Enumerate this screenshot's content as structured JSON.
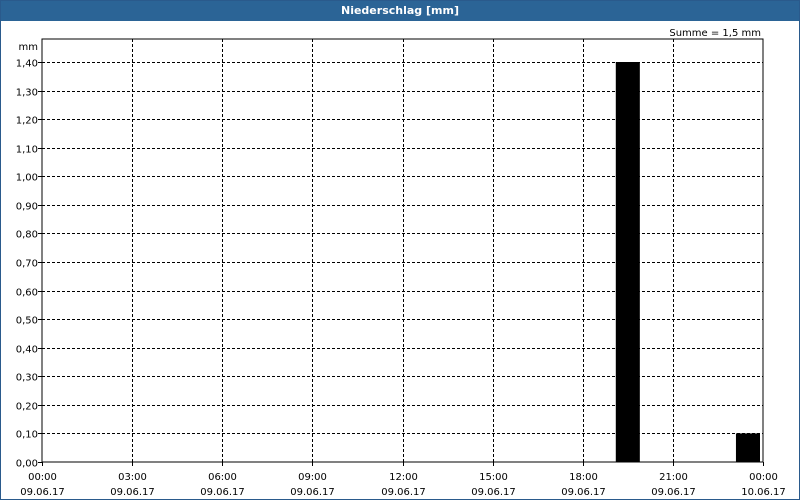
{
  "window": {
    "title": "Niederschlag [mm]"
  },
  "chart_data": {
    "type": "bar",
    "y_unit_label": "mm",
    "summary_text": "Summe = 1,5 mm",
    "ylim": [
      0,
      1.4
    ],
    "y_ticks": [
      0.0,
      0.1,
      0.2,
      0.3,
      0.4,
      0.5,
      0.6,
      0.7,
      0.8,
      0.9,
      1.0,
      1.1,
      1.2,
      1.3,
      1.4
    ],
    "y_tick_labels": [
      "0,00",
      "0,10",
      "0,20",
      "0,30",
      "0,40",
      "0,50",
      "0,60",
      "0,70",
      "0,80",
      "0,90",
      "1,00",
      "1,10",
      "1,20",
      "1,30",
      "1,40"
    ],
    "x_range_hours": [
      0,
      24
    ],
    "x_ticks": [
      {
        "hour": 0,
        "time": "00:00",
        "date": "09.06.17"
      },
      {
        "hour": 3,
        "time": "03:00",
        "date": "09.06.17"
      },
      {
        "hour": 6,
        "time": "06:00",
        "date": "09.06.17"
      },
      {
        "hour": 9,
        "time": "09:00",
        "date": "09.06.17"
      },
      {
        "hour": 12,
        "time": "12:00",
        "date": "09.06.17"
      },
      {
        "hour": 15,
        "time": "15:00",
        "date": "09.06.17"
      },
      {
        "hour": 18,
        "time": "18:00",
        "date": "09.06.17"
      },
      {
        "hour": 21,
        "time": "21:00",
        "date": "09.06.17"
      },
      {
        "hour": 24,
        "time": "00:00",
        "date": "10.06.17"
      }
    ],
    "bars": [
      {
        "start_hour": 19,
        "end_hour": 20,
        "value": 1.4
      },
      {
        "start_hour": 23,
        "end_hour": 24,
        "value": 0.1
      }
    ],
    "grid": true,
    "bar_color": "#000000"
  }
}
